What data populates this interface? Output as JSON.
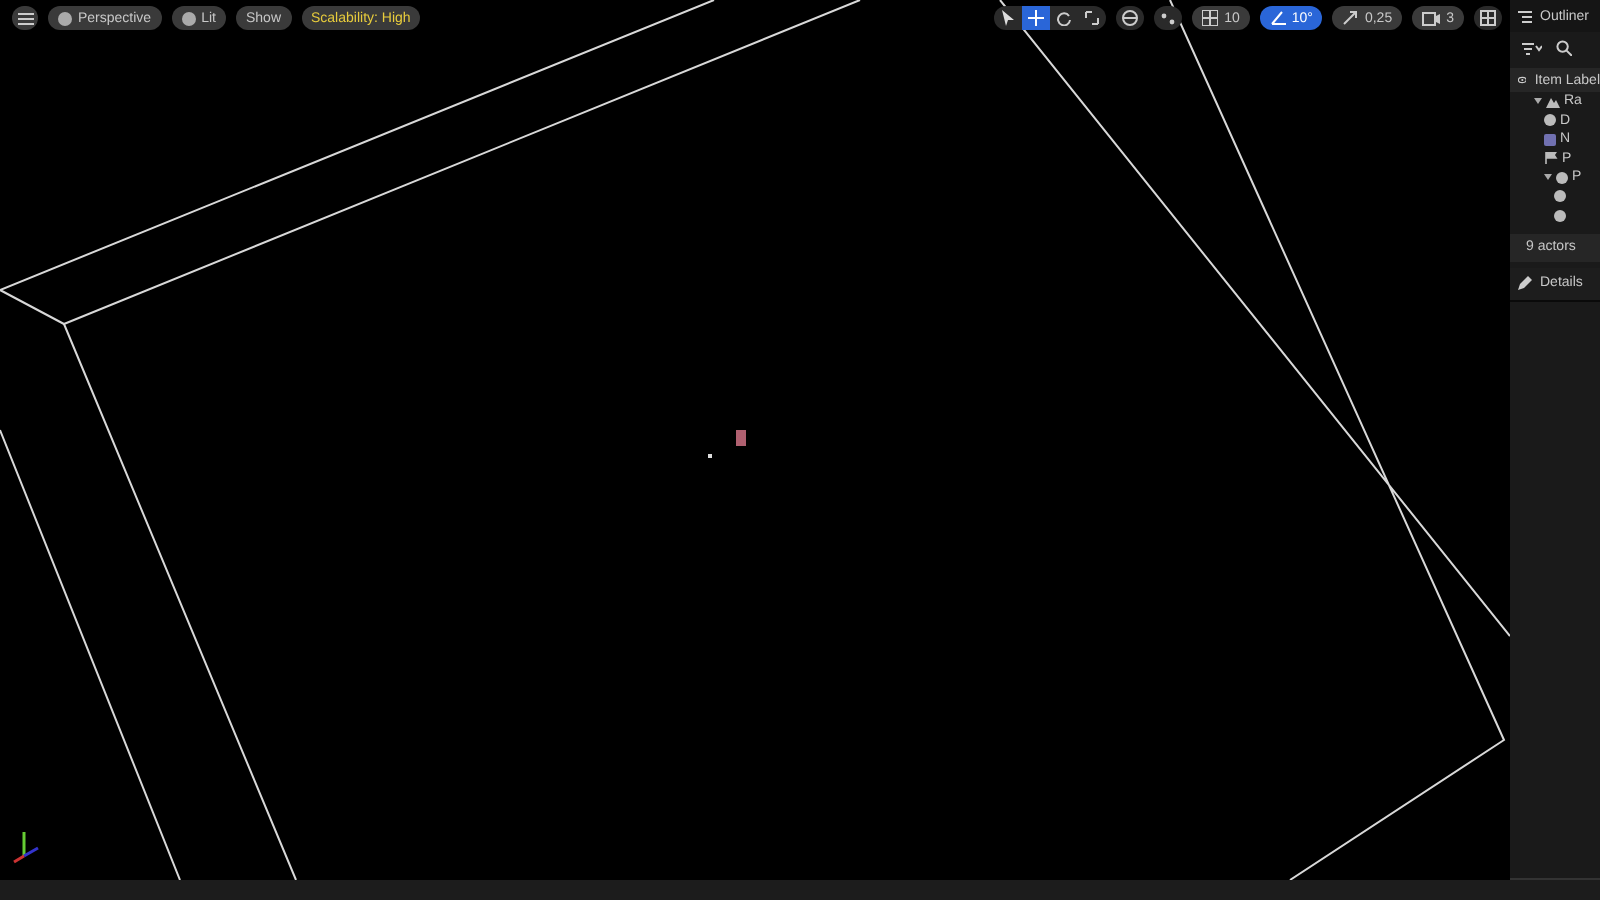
{
  "viewport": {
    "view_mode": "Perspective",
    "lighting": "Lit",
    "show": "Show",
    "scalability": "Scalability: High",
    "transform_tools": [
      {
        "kind": "select",
        "selected": false
      },
      {
        "kind": "translate",
        "selected": true
      },
      {
        "kind": "rotate",
        "selected": false
      },
      {
        "kind": "scale",
        "selected": false
      }
    ],
    "grid_snap": {
      "value": "10",
      "on": false
    },
    "rotation_snap": {
      "value": "10°",
      "on": true
    },
    "scale_snap": {
      "value": "0,25"
    },
    "camera_speed": {
      "value": "3"
    }
  },
  "outliner": {
    "title": "Outliner",
    "column": "Item Label",
    "tree": [
      {
        "kind": "level",
        "label": "Ra",
        "expanded": true,
        "children": [
          {
            "kind": "actor",
            "label": "D"
          },
          {
            "kind": "volume",
            "label": "N"
          },
          {
            "kind": "start",
            "label": "P"
          },
          {
            "kind": "actor",
            "label": "P",
            "expanded": true,
            "children": [
              {
                "kind": "actor"
              },
              {
                "kind": "actor"
              }
            ]
          }
        ]
      }
    ],
    "count": "9 actors"
  },
  "details": {
    "title": "Details"
  }
}
